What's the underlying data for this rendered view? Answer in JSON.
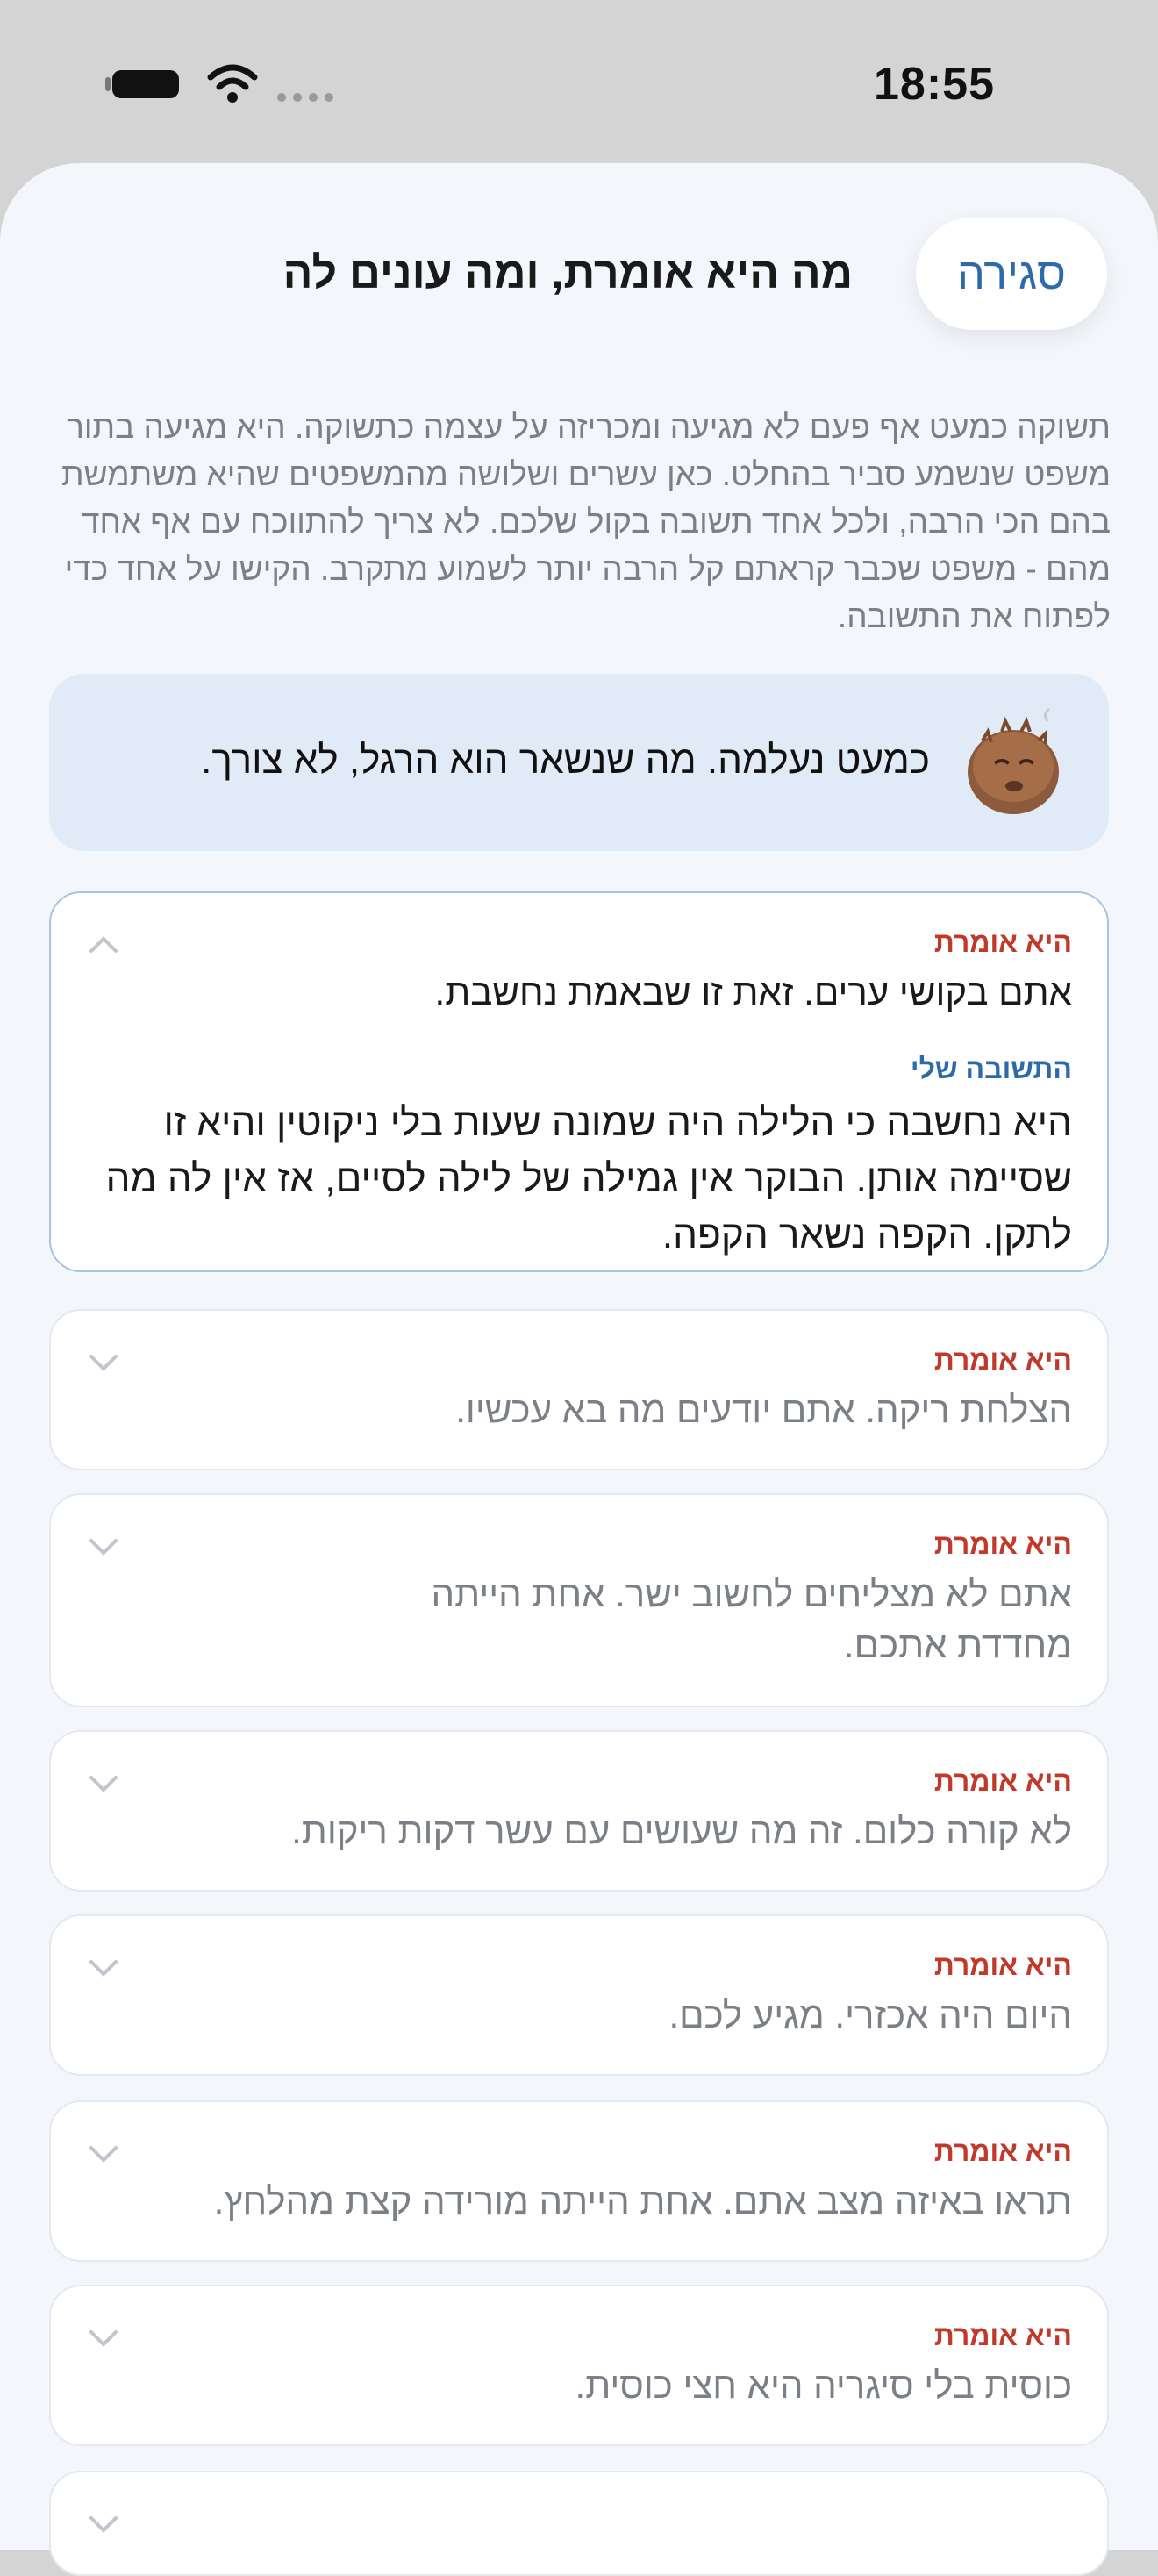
{
  "status_bar": {
    "time": "18:55",
    "icons": [
      "battery-icon",
      "wifi-icon",
      "signal-icon"
    ]
  },
  "header": {
    "close_label": "סגירה",
    "title": "מה היא אומרת, ומה עונים לה"
  },
  "intro": "תשוקה כמעט אף פעם לא מגיעה ומכריזה על עצמה כתשוקה. היא מגיעה בתור משפט שנשמע סביר בהחלט. כאן עשרים ושלושה מהמשפטים שהיא משתמשת בהם הכי הרבה, ולכל אחד תשובה בקול שלכם. לא צריך להתווכח עם אף אחד מהם - משפט שכבר קראתם קל הרבה יותר לשמוע מתקרב. הקישו על אחד כדי לפתוח את התשובה.",
  "banner": {
    "avatar_icon": "craving-creature-avatar",
    "text": "כמעט נעלמה. מה שנשאר הוא הרגל, לא צורך."
  },
  "labels": {
    "she_says": "היא אומרת",
    "my_reply": "התשובה שלי"
  },
  "colors": {
    "accent_blue": "#2d6aa8",
    "label_red": "#c0392b",
    "sheet_bg": "#f3f6fa",
    "banner_bg": "#e1ebf7"
  },
  "items": [
    {
      "says": "אתם בקושי ערים. זאת זו שבאמת נחשבת.",
      "reply": "היא נחשבה כי הלילה היה שמונה שעות בלי ניקוטין והיא זו שסיימה אותן. הבוקר אין גמילה של לילה לסיים, אז אין לה מה לתקן. הקפה נשאר הקפה.",
      "expanded": true
    },
    {
      "says": "הצלחת ריקה. אתם יודעים מה בא עכשיו.",
      "expanded": false
    },
    {
      "says": "אתם לא מצליחים לחשוב ישר. אחת הייתה מחדדת אתכם.",
      "expanded": false
    },
    {
      "says": "לא קורה כלום. זה מה שעושים עם עשר דקות ריקות.",
      "expanded": false
    },
    {
      "says": "היום היה אכזרי. מגיע לכם.",
      "expanded": false
    },
    {
      "says": "תראו באיזה מצב אתם. אחת הייתה מורידה קצת מהלחץ.",
      "expanded": false
    },
    {
      "says": "כוסית בלי סיגריה היא חצי כוסית.",
      "expanded": false
    }
  ]
}
